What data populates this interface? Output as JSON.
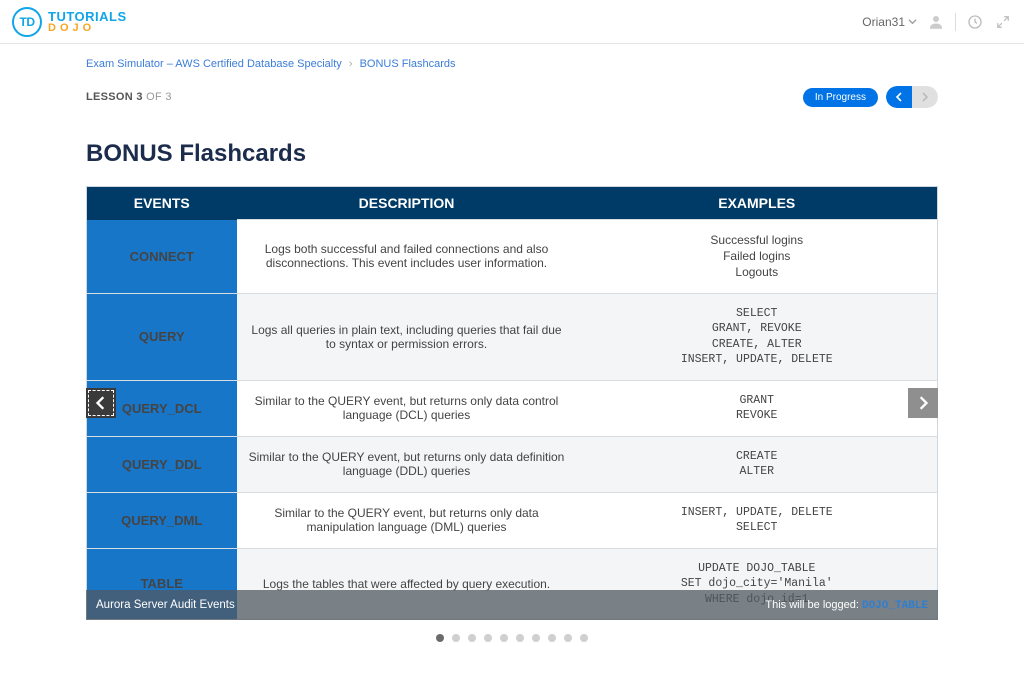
{
  "brand": {
    "mark": "TD",
    "line1": "TUTORIALS",
    "line2": "DOJO"
  },
  "user": {
    "name": "Orian31"
  },
  "breadcrumb": {
    "item1": "Exam Simulator – AWS Certified Database Specialty",
    "sep": "›",
    "item2": "BONUS Flashcards"
  },
  "lesson": {
    "label": "LESSON",
    "current": "3",
    "of": "OF 3"
  },
  "status_pill": "In Progress",
  "page_title": "BONUS Flashcards",
  "table": {
    "headers": {
      "events": "EVENTS",
      "description": "DESCRIPTION",
      "examples": "EXAMPLES"
    },
    "rows": [
      {
        "event": "CONNECT",
        "desc": "Logs both successful and failed connections and also disconnections. This event includes user information.",
        "example_plain": "Successful logins\nFailed logins\nLogouts"
      },
      {
        "event": "QUERY",
        "desc": "Logs all queries in plain text, including queries that fail due to syntax or permission errors.",
        "example_mono": "SELECT\nGRANT, REVOKE\nCREATE, ALTER\nINSERT, UPDATE, DELETE"
      },
      {
        "event": "QUERY_DCL",
        "desc": "Similar to the QUERY event, but returns only data control language (DCL) queries",
        "example_mono": "GRANT\nREVOKE"
      },
      {
        "event": "QUERY_DDL",
        "desc": "Similar to the QUERY event, but returns only data definition language (DDL) queries",
        "example_mono": "CREATE\nALTER"
      },
      {
        "event": "QUERY_DML",
        "desc": "Similar to the QUERY event, but returns only data manipulation language (DML) queries",
        "example_mono": "INSERT, UPDATE, DELETE\nSELECT"
      },
      {
        "event": "TABLE",
        "desc": "Logs the tables that were affected by query execution.",
        "example_mono": "UPDATE DOJO_TABLE\nSET dojo_city='Manila'\nWHERE dojo_id=1"
      }
    ]
  },
  "caption": {
    "left": "Aurora Server Audit Events",
    "right_prefix": "This will be logged: ",
    "right_hl": "DOJO_TABLE"
  },
  "dots": {
    "count": 10,
    "active": 0
  }
}
